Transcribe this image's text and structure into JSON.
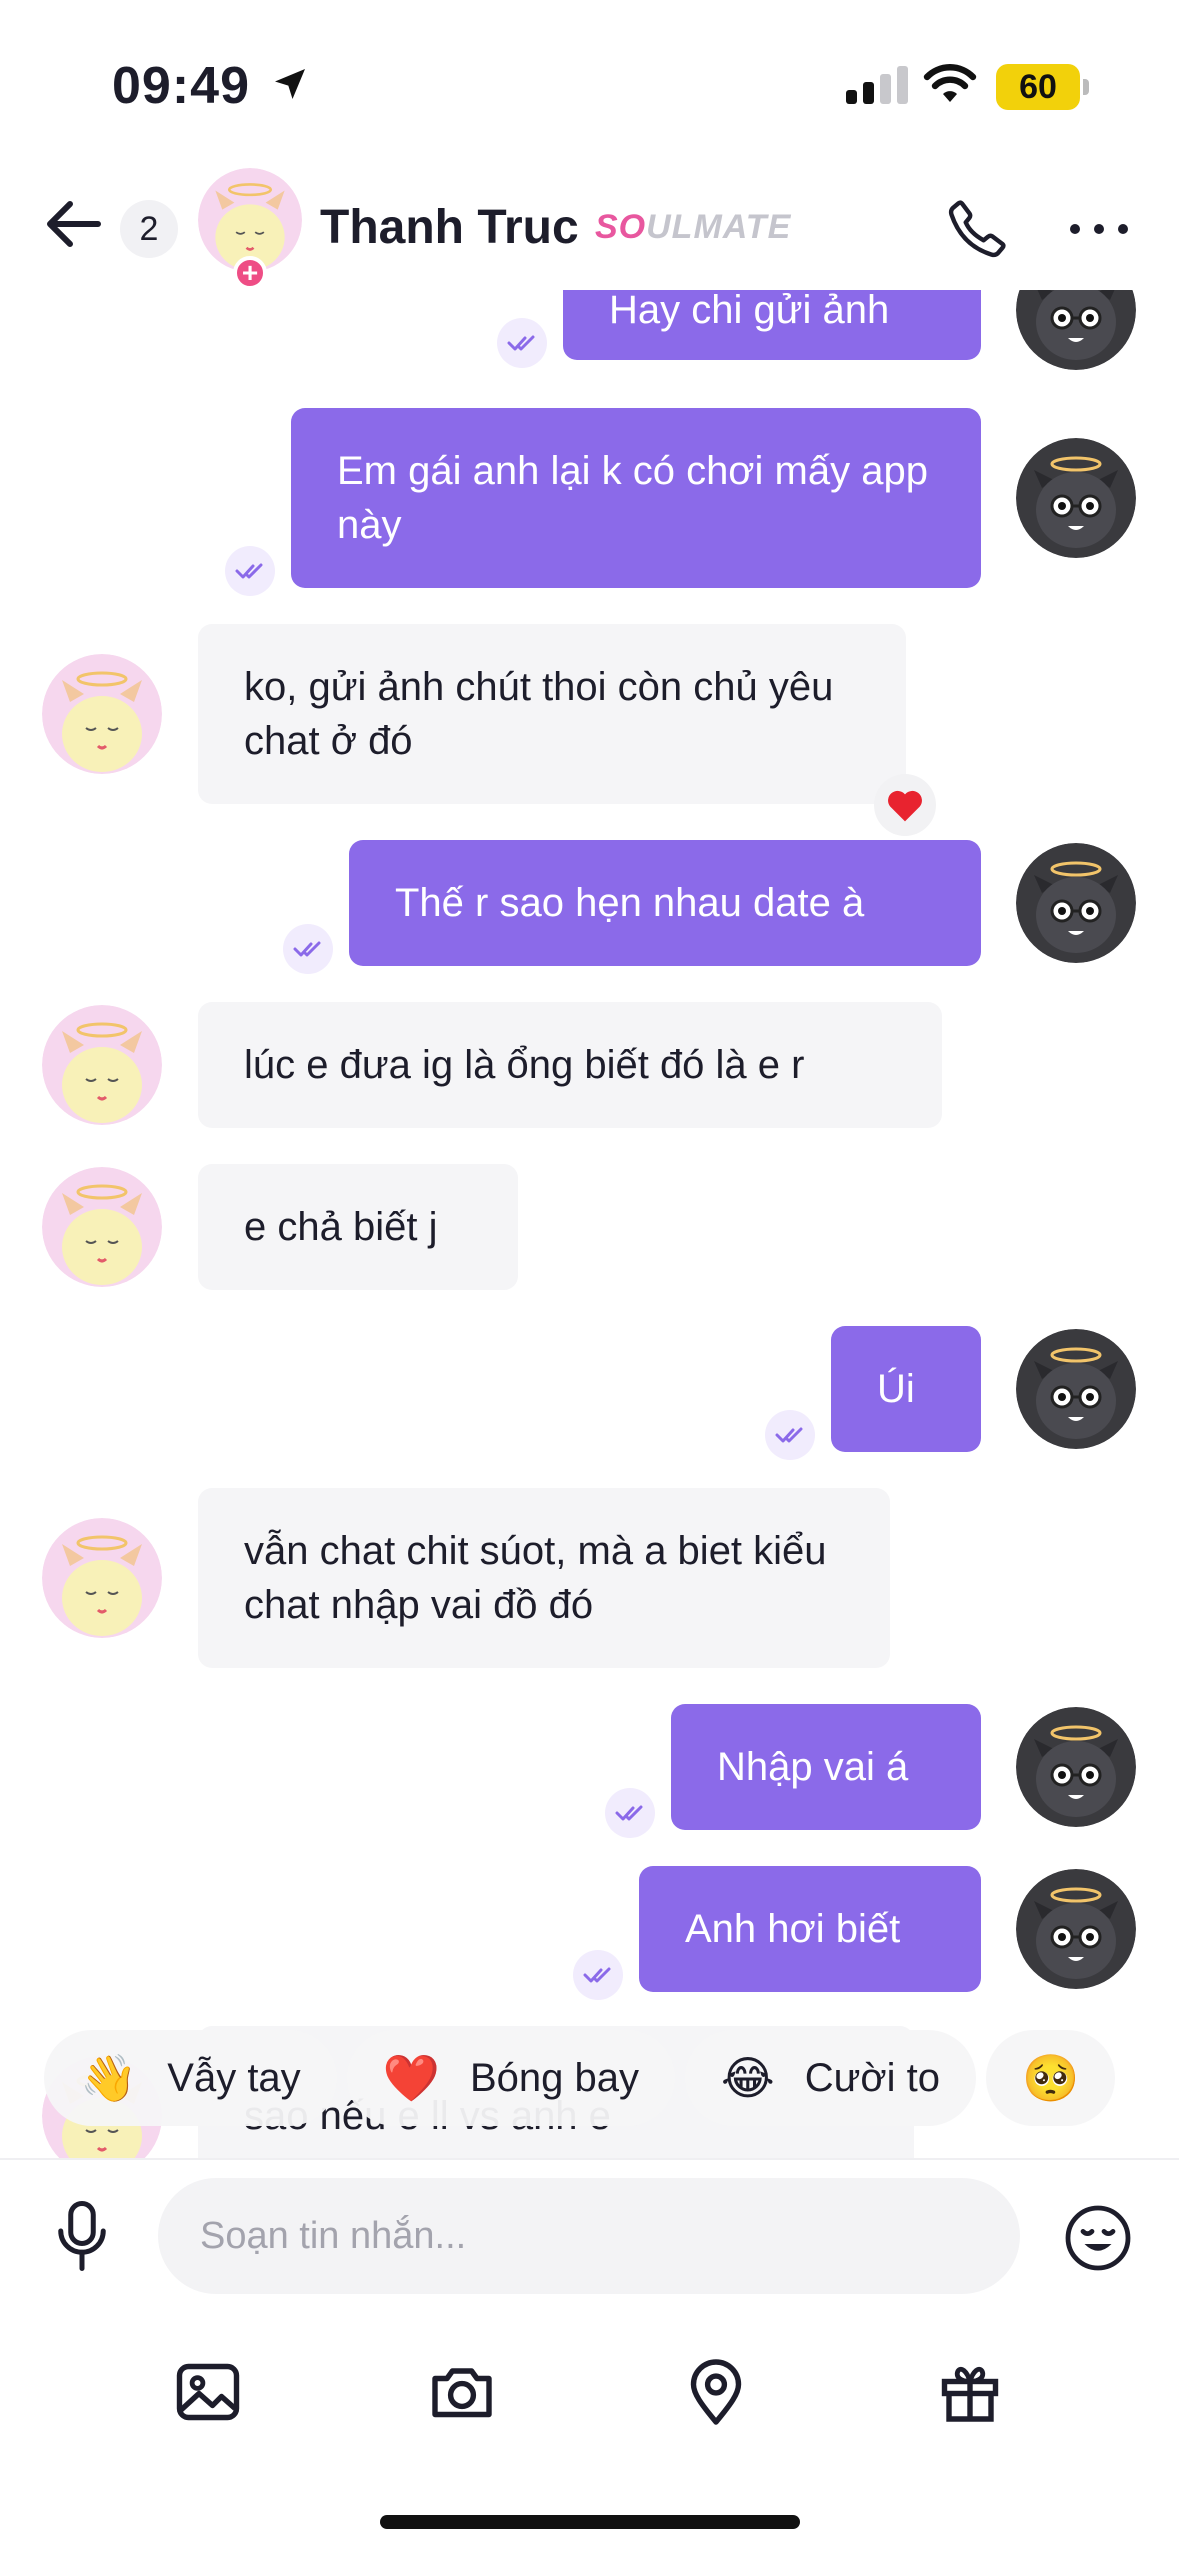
{
  "status_bar": {
    "time": "09:49",
    "battery": "60"
  },
  "header": {
    "unread_count": "2",
    "contact_name": "Thanh Truc",
    "badge_so": "SO",
    "badge_rest": "ULMATE"
  },
  "messages": [
    {
      "dir": "out",
      "text": "Hay chi gửi ảnh"
    },
    {
      "dir": "out",
      "text": "Em gái anh lại k có chơi mấy app này"
    },
    {
      "dir": "in",
      "text": "ko, gửi ảnh chút thoi còn chủ yêu chat ở đó",
      "reaction": "heart"
    },
    {
      "dir": "out",
      "text": "Thế r sao hẹn nhau date à"
    },
    {
      "dir": "in",
      "text": "lúc e đưa ig là ổng biết đó là e r"
    },
    {
      "dir": "in",
      "text": "e chả biết j"
    },
    {
      "dir": "out",
      "text": "Úi"
    },
    {
      "dir": "in",
      "text": "vẫn chat chit súot, mà a biet kiểu chat nhập vai đồ đó"
    },
    {
      "dir": "out",
      "text": "Nhập vai á"
    },
    {
      "dir": "out",
      "text": "Anh hơi biết"
    },
    {
      "dir": "in",
      "text": "sao nếu e ll vs anh e"
    }
  ],
  "quick_reactions": [
    {
      "emoji": "👋",
      "label": "Vẫy tay"
    },
    {
      "emoji": "❤️",
      "label": "Bóng bay"
    },
    {
      "emoji": "😂",
      "label": "Cười to"
    },
    {
      "emoji": "🥺",
      "label": ""
    }
  ],
  "composer": {
    "placeholder": "Soạn tin nhắn..."
  },
  "colors": {
    "accent": "#8b6ae9",
    "incoming_bg": "#f5f5f7",
    "badge_pink": "#e8579f",
    "battery": "#f2d10b"
  }
}
